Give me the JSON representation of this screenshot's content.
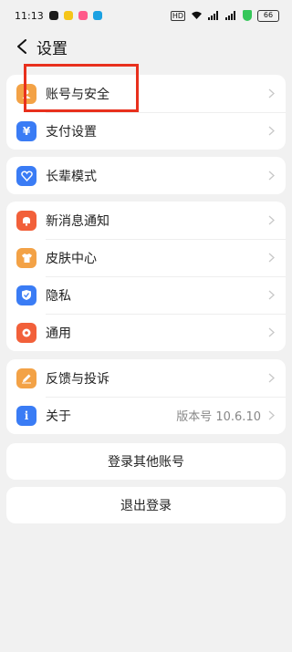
{
  "status_bar": {
    "time": "11:13",
    "hd_label": "HD",
    "battery_level": "66",
    "app_icon_colors": [
      "#1a1a1a",
      "#f5c518",
      "#ff5a8a",
      "#1ba1e2"
    ]
  },
  "header": {
    "title": "设置"
  },
  "groups": [
    {
      "items": [
        {
          "label": "账号与安全",
          "icon": "account-icon",
          "color": "#f3a246"
        },
        {
          "label": "支付设置",
          "icon": "payment-yen-icon",
          "color": "#3a7cf5"
        }
      ]
    },
    {
      "items": [
        {
          "label": "长辈模式",
          "icon": "elder-heart-icon",
          "color": "#3a7cf5"
        }
      ]
    },
    {
      "items": [
        {
          "label": "新消息通知",
          "icon": "bell-icon",
          "color": "#f2603a"
        },
        {
          "label": "皮肤中心",
          "icon": "tshirt-icon",
          "color": "#f3a246"
        },
        {
          "label": "隐私",
          "icon": "shield-check-icon",
          "color": "#3a7cf5"
        },
        {
          "label": "通用",
          "icon": "gear-icon",
          "color": "#f2603a"
        }
      ]
    },
    {
      "items": [
        {
          "label": "反馈与投诉",
          "icon": "pencil-icon",
          "color": "#f3a246"
        },
        {
          "label": "关于",
          "icon": "info-icon",
          "color": "#3a7cf5",
          "value": "版本号 10.6.10"
        }
      ]
    }
  ],
  "buttons": {
    "switch_account": "登录其他账号",
    "logout": "退出登录"
  },
  "annotation": {
    "highlight_color": "#e8301d"
  }
}
